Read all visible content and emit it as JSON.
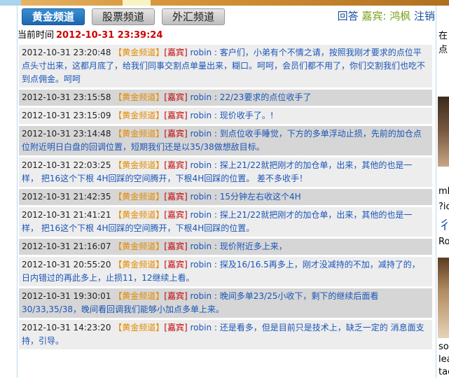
{
  "tabs": [
    {
      "label": "黄金频道",
      "active": true
    },
    {
      "label": "股票频道",
      "active": false
    },
    {
      "label": "外汇频道",
      "active": false
    }
  ],
  "header_links": {
    "reply": "回答",
    "guest_label": "嘉宾: 鸿枫",
    "logout": "注销"
  },
  "current_time": {
    "label": "当前时间",
    "value": "2012-10-31 23:39:24"
  },
  "messages": [
    {
      "ts": "2012-10-31 23:20:48",
      "channel": "【黄金频道】",
      "guest": "[嘉宾]",
      "user": "robin",
      "text": " : 客户们，小弟有个不情之请，按照我刚才要求的点位平点头寸出来，这都月底了，给我们同事交割点单量出来，糊口。呵呵，会员们都不用了，你们交割我们也吃不到点佣金。呵呵"
    },
    {
      "ts": "2012-10-31 23:15:58",
      "channel": "【黄金频道】",
      "guest": "[嘉宾]",
      "user": "robin",
      "text": " : 22/23要求的点位收手了"
    },
    {
      "ts": "2012-10-31 23:15:09",
      "channel": "【黄金频道】",
      "guest": "[嘉宾]",
      "user": "robin",
      "text": " : 现价收手了。!"
    },
    {
      "ts": "2012-10-31 23:14:48",
      "channel": "【黄金频道】",
      "guest": "[嘉宾]",
      "user": "robin",
      "text": " : 到点位收手睡觉，下方的多单浮动止损，先前的加仓点位附近明日白盘的回调位置，短期我们还是以35/38做想敌目标。"
    },
    {
      "ts": "2012-10-31 22:03:25",
      "channel": "【黄金频道】",
      "guest": "[嘉宾]",
      "user": "robin",
      "text": " : 探上21/22就把刚才的加仓单，出来，其他的也是一样， 把16这个下根 4H回踩的空间腾开，下根4H回踩的位置。 差不多收手！"
    },
    {
      "ts": "2012-10-31 21:42:35",
      "channel": "【黄金频道】",
      "guest": "[嘉宾]",
      "user": "robin",
      "text": " : 15分钟左右收这个4H"
    },
    {
      "ts": "2012-10-31 21:41:21",
      "channel": "【黄金频道】",
      "guest": "[嘉宾]",
      "user": "robin",
      "text": " : 探上21/22就把刚才的加仓单，出来，其他的也是一样， 把16这个下根 4H回踩的空间腾开，下根4H回踩的位置。"
    },
    {
      "ts": "2012-10-31 21:16:07",
      "channel": "【黄金频道】",
      "guest": "[嘉宾]",
      "user": "robin",
      "text": " : 现价附近多上来，"
    },
    {
      "ts": "2012-10-31 20:55:20",
      "channel": "【黄金频道】",
      "guest": "[嘉宾]",
      "user": "robin",
      "text": " : 探及16/16.5再多上，刚才没减持的不加，减持了的，日内错过的再此多上，止损11，12继续上看。"
    },
    {
      "ts": "2012-10-31 19:30:01",
      "channel": "【黄金频道】",
      "guest": "[嘉宾]",
      "user": "robin",
      "text": " : 晚间多单23/25小收下，剩下的继续后面看30/33,35/38，晚间看回调我们能够小加点多单上来。"
    },
    {
      "ts": "2012-10-31 14:23:20",
      "channel": "【黄金频道】",
      "guest": "[嘉宾]",
      "user": "robin",
      "text": " : 还是看多，但是目前只是技术上，缺乏一定的 消息面支持，引导。"
    }
  ],
  "right_panel_fragments": [
    "在",
    "点",
    "mb",
    "?ic",
    "彳",
    "Ro",
    "soc",
    "lea",
    "tac"
  ]
}
